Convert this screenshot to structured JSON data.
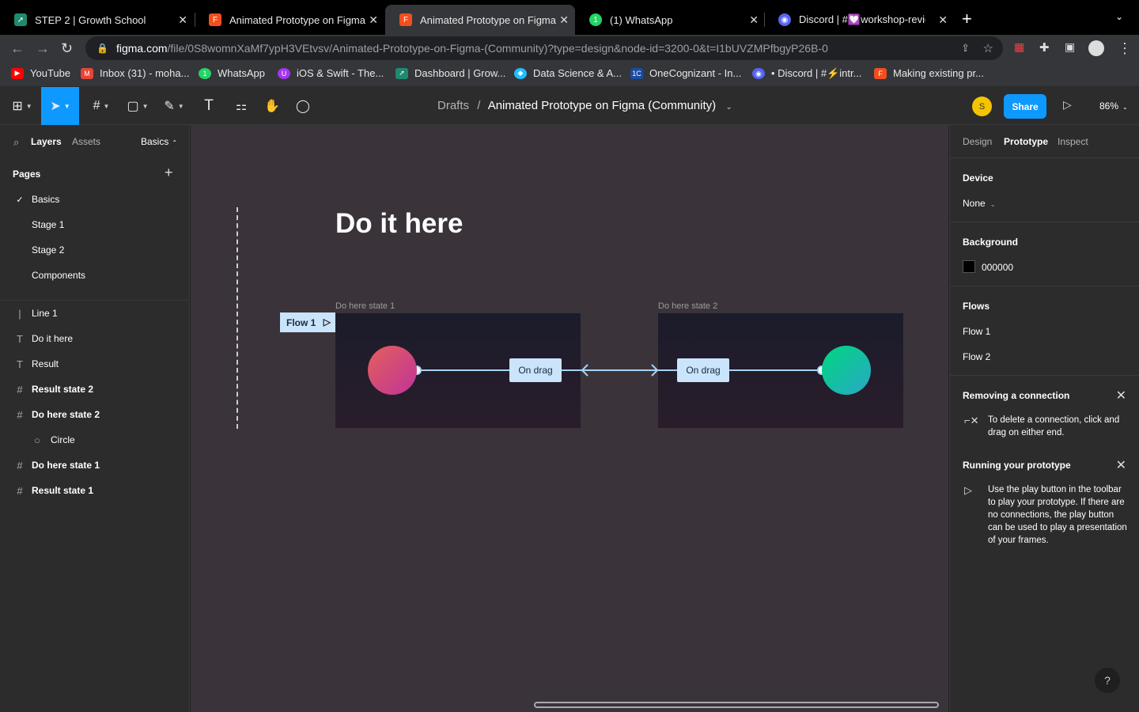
{
  "browser": {
    "tabs": [
      {
        "title": "STEP 2 | Growth School",
        "icon": "growth-school-icon",
        "color": "#1f8a70"
      },
      {
        "title": "Animated Prototype on Figma -",
        "icon": "figma-icon",
        "color": "#f24e1e"
      },
      {
        "title": "Animated Prototype on Figma (",
        "icon": "figma-icon",
        "color": "#f24e1e"
      },
      {
        "title": "(1) WhatsApp",
        "icon": "whatsapp-icon",
        "color": "#25d366"
      },
      {
        "title": "Discord | #💟workshop-review",
        "icon": "discord-icon",
        "color": "#5865f2"
      }
    ],
    "new_tab": "+",
    "url_domain": "figma.com",
    "url_path": "/file/0S8womnXaMf7ypH3VEtvsv/Animated-Prototype-on-Figma-(Community)?type=design&node-id=3200-0&t=I1bUVZMPfbgyP26B-0",
    "bookmarks": [
      {
        "label": "YouTube",
        "icon": "youtube-icon",
        "color": "#ff0000"
      },
      {
        "label": "Inbox (31) - moha...",
        "icon": "gmail-icon",
        "color": "#ea4335"
      },
      {
        "label": "WhatsApp",
        "icon": "whatsapp-icon",
        "color": "#25d366"
      },
      {
        "label": "iOS & Swift - The...",
        "icon": "udemy-icon",
        "color": "#a435f0"
      },
      {
        "label": "Dashboard | Grow...",
        "icon": "growth-school-icon",
        "color": "#1f8a70"
      },
      {
        "label": "Data Science & A...",
        "icon": "datascience-icon",
        "color": "#20beff"
      },
      {
        "label": "OneCognizant - In...",
        "icon": "cognizant-icon",
        "color": "#1a4ca1"
      },
      {
        "label": "• Discord | #⚡intr...",
        "icon": "discord-icon",
        "color": "#5865f2"
      },
      {
        "label": "Making existing pr...",
        "icon": "figma-icon",
        "color": "#f24e1e"
      }
    ]
  },
  "toolbar": {
    "breadcrumb_root": "Drafts",
    "separator": "/",
    "file_name": "Animated Prototype on Figma (Community)",
    "avatar_initial": "S",
    "share_label": "Share",
    "zoom": "86%"
  },
  "left_panel": {
    "tabs": [
      "Layers",
      "Assets"
    ],
    "page_selector": "Basics",
    "pages_heading": "Pages",
    "pages": [
      "Basics",
      "Stage 1",
      "Stage 2",
      "Components"
    ],
    "layers": [
      {
        "name": "Line 1",
        "icon": "line-icon",
        "bold": false,
        "indent": false
      },
      {
        "name": "Do it here",
        "icon": "text-icon",
        "bold": false,
        "indent": false
      },
      {
        "name": "Result",
        "icon": "text-icon",
        "bold": false,
        "indent": false
      },
      {
        "name": "Result state 2",
        "icon": "frame-icon",
        "bold": true,
        "indent": false
      },
      {
        "name": "Do here state 2",
        "icon": "frame-icon",
        "bold": true,
        "indent": false
      },
      {
        "name": "Circle",
        "icon": "ellipse-icon",
        "bold": false,
        "indent": true
      },
      {
        "name": "Do here state 1",
        "icon": "frame-icon",
        "bold": true,
        "indent": false
      },
      {
        "name": "Result state 1",
        "icon": "frame-icon",
        "bold": true,
        "indent": false
      }
    ]
  },
  "canvas": {
    "heading": "Do it here",
    "frame1_label": "Do here state 1",
    "frame2_label": "Do here state 2",
    "flow_tag": "Flow 1",
    "drag_label_1": "On drag",
    "drag_label_2": "On drag"
  },
  "right_panel": {
    "tabs": [
      "Design",
      "Prototype",
      "Inspect"
    ],
    "device_heading": "Device",
    "device_value": "None",
    "background_heading": "Background",
    "background_value": "000000",
    "flows_heading": "Flows",
    "flows": [
      "Flow 1",
      "Flow 2"
    ],
    "tip1_heading": "Removing a connection",
    "tip1_text": "To delete a connection, click and drag on either end.",
    "tip2_heading": "Running your prototype",
    "tip2_text": "Use the play button in the toolbar to play your prototype. If there are no connections, the play button can be used to play a presentation of your frames."
  },
  "help_label": "?"
}
